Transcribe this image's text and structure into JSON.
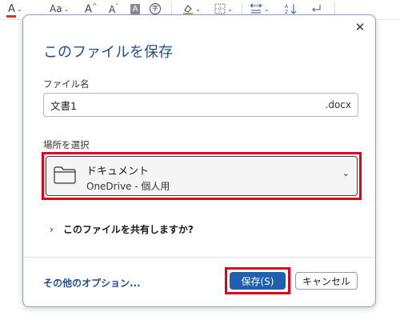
{
  "ribbon": {
    "font_color_icon": "font-color-icon",
    "font_size_icon": "change-case-icon",
    "grow_font_icon": "grow-font-icon",
    "shrink_font_icon": "shrink-font-icon",
    "highlight_icon": "text-highlight-icon",
    "phonetic_icon": "phonetic-guide-icon",
    "shading_icon": "shading-icon",
    "borders_icon": "borders-icon",
    "spacing_icon": "spacing-icon",
    "sort_icon": "sort-icon",
    "paragraph_icon": "paragraph-mark-icon",
    "labels": {
      "font_color": "A",
      "change_case": "Aa",
      "grow": "A",
      "shrink": "A",
      "highlight": "A",
      "phonetic": "字"
    },
    "accent_color": "#e0301e"
  },
  "dialog": {
    "title": "このファイルを保存",
    "filename_label": "ファイル名",
    "filename_value": "文書1",
    "extension": ".docx",
    "location_label": "場所を選択",
    "location": {
      "name": "ドキュメント",
      "sub": "OneDrive - 個人用"
    },
    "share_text": "このファイルを共有しますか?",
    "more_options": "その他のオプション...",
    "save_label": "保存(S)",
    "cancel_label": "キャンセル",
    "title_color": "#1f4f8f",
    "primary_color": "#1f5fad",
    "highlight_color": "#e0001b"
  }
}
